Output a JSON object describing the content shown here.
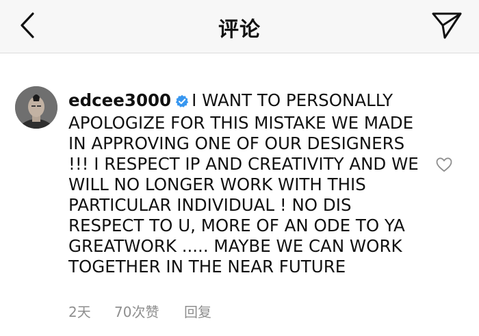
{
  "header": {
    "title": "评论",
    "icons": {
      "back": "chevron-left-icon",
      "share": "paper-plane-icon"
    }
  },
  "comment": {
    "username": "edcee3000",
    "verified": true,
    "text": "I WANT TO PERSONALLY APOLOGIZE FOR THIS MISTAKE WE MADE IN APPROVING ONE OF OUR DESIGNERS !!! I RESPECT IP AND CREATIVITY AND WE WILL NO LONGER WORK WITH THIS PARTICULAR INDIVIDUAL ! NO DIS RESPECT TO U, MORE OF AN ODE TO YA GREATWORK ..... MAYBE WE CAN WORK TOGETHER IN THE NEAR FUTURE",
    "time": "2天",
    "likes": "70次赞",
    "reply_label": "回复"
  },
  "colors": {
    "verified_badge": "#3897f0",
    "meta_text": "#8e8e8e",
    "header_bg": "#f7f7f7"
  }
}
